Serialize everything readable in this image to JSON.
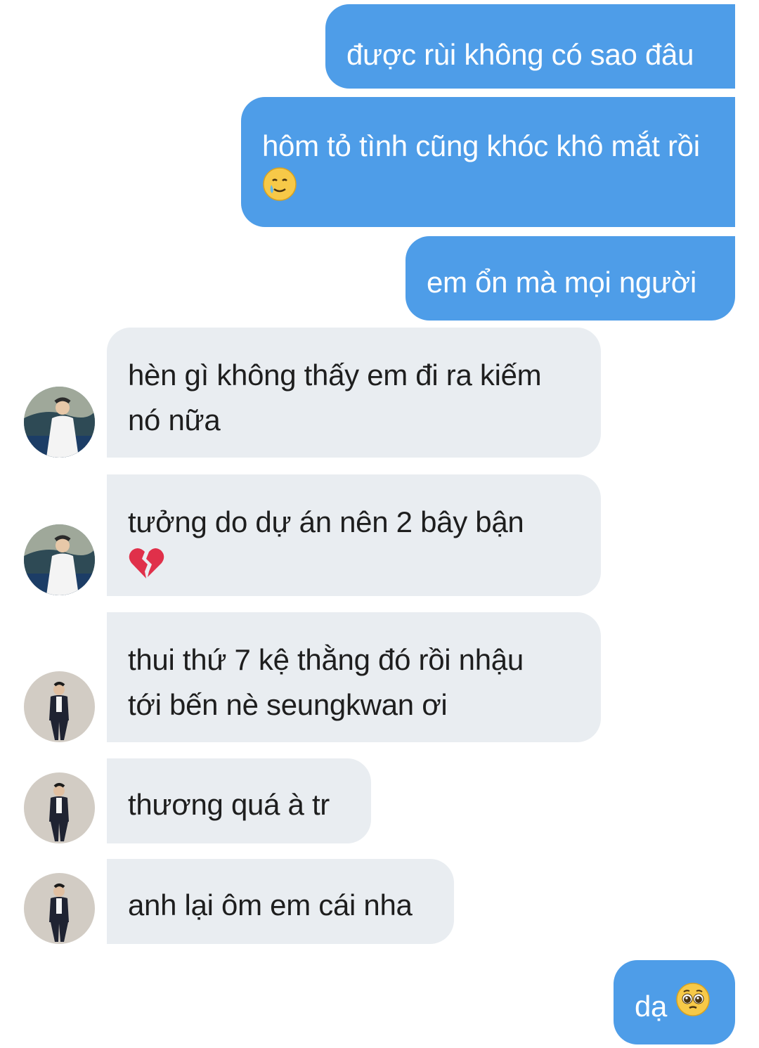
{
  "messages": [
    {
      "text": "được rùi không có sao đâu"
    },
    {
      "text": "hôm tỏ tình cũng khóc khô mắt rồi",
      "emoji": "smiling-face-with-tear"
    },
    {
      "text": "em ổn mà mọi người"
    },
    {
      "line1": "hèn gì không thấy em đi ra kiếm",
      "line2": "nó nữa"
    },
    {
      "line1": "tưởng do dự án nên 2 bây bận",
      "emoji": "broken-heart"
    },
    {
      "line1": "thui thứ 7 kệ thằng đó rồi nhậu",
      "line2": "tới bến nè seungkwan ơi"
    },
    {
      "text": "thương quá à tr"
    },
    {
      "text": "anh lại ôm em cái nha"
    },
    {
      "text": "dạ",
      "emoji": "pleading-face"
    }
  ],
  "colors": {
    "sent_bubble": "#4e9de8",
    "received_bubble": "#e9edf1",
    "sent_text": "#ffffff",
    "received_text": "#1e1e1e"
  }
}
